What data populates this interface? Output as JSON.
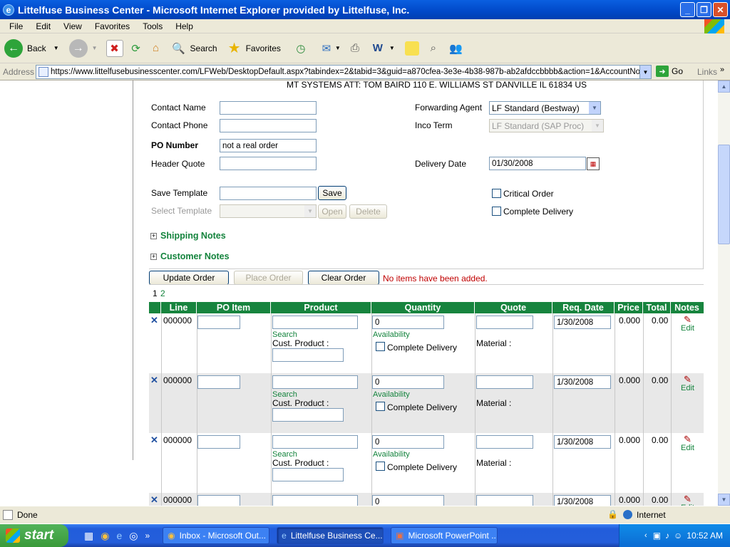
{
  "window": {
    "title": "Littelfuse Business Center - Microsoft Internet Explorer provided by Littelfuse, Inc."
  },
  "menu": [
    "File",
    "Edit",
    "View",
    "Favorites",
    "Tools",
    "Help"
  ],
  "toolbar": {
    "back": "Back",
    "search": "Search",
    "favorites": "Favorites"
  },
  "address": {
    "label": "Address",
    "url": "https://www.littelfusebusinesscenter.com/LFWeb/DesktopDefault.aspx?tabindex=2&tabid=3&guid=a870cfea-3e3e-4b38-987b-ab2afdccbbbb&action=1&AccountNoFrom=",
    "go": "Go",
    "links": "Links"
  },
  "form": {
    "ship_to": "MT SYSTEMS ATT: TOM BAIRD 110 E. WILLIAMS ST DANVILLE IL 61834 US",
    "contact_name_label": "Contact Name",
    "contact_phone_label": "Contact Phone",
    "po_number_label": "PO Number",
    "po_number_value": "not a real order",
    "header_quote_label": "Header Quote",
    "forwarding_agent_label": "Forwarding Agent",
    "forwarding_agent_value": "LF Standard (Bestway)",
    "inco_term_label": "Inco Term",
    "inco_term_value": "LF Standard (SAP Proc)",
    "delivery_date_label": "Delivery Date",
    "delivery_date_value": "01/30/2008",
    "save_template_label": "Save Template",
    "save_button": "Save",
    "select_template_label": "Select Template",
    "open_button": "Open",
    "delete_button": "Delete",
    "critical_order_label": "Critical Order",
    "complete_delivery_label": "Complete Delivery",
    "shipping_notes": "Shipping Notes",
    "customer_notes": "Customer Notes",
    "update_order": "Update Order",
    "place_order": "Place Order",
    "clear_order": "Clear Order",
    "message": "No items have been added."
  },
  "pager": {
    "current": "1",
    "next": "2"
  },
  "grid": {
    "headers": [
      "Line",
      "PO Item",
      "Product",
      "Quantity",
      "Quote",
      "Req. Date",
      "Price",
      "Total",
      "Notes"
    ],
    "search_label": "Search",
    "cust_product_label": "Cust. Product :",
    "availability_label": "Availability",
    "complete_delivery_label": "Complete Delivery",
    "material_label": "Material :",
    "edit_label": "Edit",
    "rows": [
      {
        "line": "000000",
        "quantity": "0",
        "req_date": "1/30/2008",
        "price": "0.000",
        "total": "0.00"
      },
      {
        "line": "000000",
        "quantity": "0",
        "req_date": "1/30/2008",
        "price": "0.000",
        "total": "0.00"
      },
      {
        "line": "000000",
        "quantity": "0",
        "req_date": "1/30/2008",
        "price": "0.000",
        "total": "0.00"
      },
      {
        "line": "000000",
        "quantity": "0",
        "req_date": "1/30/2008",
        "price": "0.000",
        "total": "0.00"
      }
    ]
  },
  "status": {
    "text": "Done",
    "zone": "Internet"
  },
  "taskbar": {
    "start": "start",
    "tasks": [
      "Inbox - Microsoft Out...",
      "Littelfuse Business Ce...",
      "Microsoft PowerPoint ..."
    ],
    "clock": "10:52 AM"
  }
}
